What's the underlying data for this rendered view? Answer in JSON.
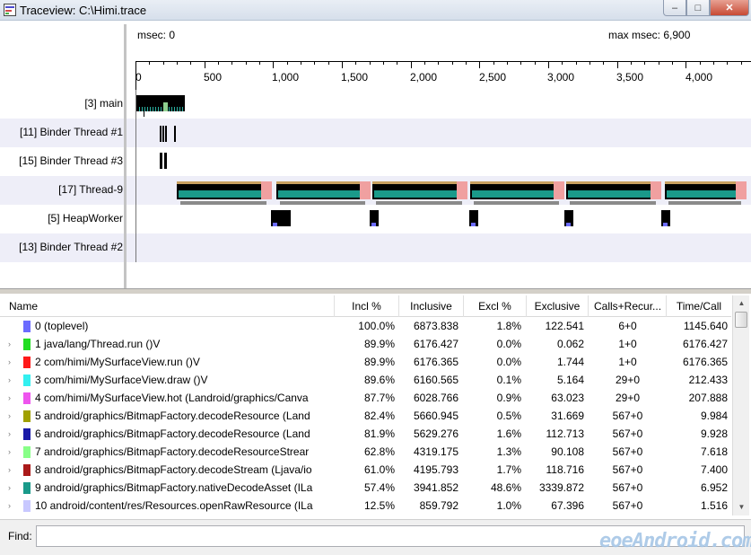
{
  "window": {
    "title": "Traceview: C:\\Himi.trace",
    "min_glyph": "–",
    "max_glyph": "□",
    "close_glyph": "✕"
  },
  "timeline": {
    "msec_start": "msec: 0",
    "max_msec": "max msec: 6,900",
    "tick_labels": [
      "0",
      "500",
      "1,000",
      "1,500",
      "2,000",
      "2,500",
      "3,000",
      "3,500",
      "4,000"
    ],
    "threads": [
      {
        "label": "[3] main"
      },
      {
        "label": "[11] Binder Thread #1"
      },
      {
        "label": "[15] Binder Thread #3"
      },
      {
        "label": "[17] Thread-9"
      },
      {
        "label": "[5] HeapWorker"
      },
      {
        "label": "[13] Binder Thread #2"
      }
    ]
  },
  "table": {
    "columns": [
      "Name",
      "Incl %",
      "Inclusive",
      "Excl %",
      "Exclusive",
      "Calls+Recur...",
      "Time/Call"
    ],
    "rows": [
      {
        "name": "0 (toplevel)",
        "color": "#6b6bff",
        "expander": "",
        "incl_pct": "100.0%",
        "inclusive": "6873.838",
        "excl_pct": "1.8%",
        "exclusive": "122.541",
        "calls": "6+0",
        "time_call": "1145.640"
      },
      {
        "name": "1 java/lang/Thread.run ()V",
        "color": "#22dd22",
        "expander": "›",
        "incl_pct": "89.9%",
        "inclusive": "6176.427",
        "excl_pct": "0.0%",
        "exclusive": "0.062",
        "calls": "1+0",
        "time_call": "6176.427"
      },
      {
        "name": "2 com/himi/MySurfaceView.run ()V",
        "color": "#ff1a1a",
        "expander": "›",
        "incl_pct": "89.9%",
        "inclusive": "6176.365",
        "excl_pct": "0.0%",
        "exclusive": "1.744",
        "calls": "1+0",
        "time_call": "6176.365"
      },
      {
        "name": "3 com/himi/MySurfaceView.draw ()V",
        "color": "#33f0f0",
        "expander": "›",
        "incl_pct": "89.6%",
        "inclusive": "6160.565",
        "excl_pct": "0.1%",
        "exclusive": "5.164",
        "calls": "29+0",
        "time_call": "212.433"
      },
      {
        "name": "4 com/himi/MySurfaceView.hot (Landroid/graphics/Canva",
        "color": "#ee55ee",
        "expander": "›",
        "incl_pct": "87.7%",
        "inclusive": "6028.766",
        "excl_pct": "0.9%",
        "exclusive": "63.023",
        "calls": "29+0",
        "time_call": "207.888"
      },
      {
        "name": "5 android/graphics/BitmapFactory.decodeResource (Land",
        "color": "#a0a000",
        "expander": "›",
        "incl_pct": "82.4%",
        "inclusive": "5660.945",
        "excl_pct": "0.5%",
        "exclusive": "31.669",
        "calls": "567+0",
        "time_call": "9.984"
      },
      {
        "name": "6 android/graphics/BitmapFactory.decodeResource (Land",
        "color": "#1a1aa8",
        "expander": "›",
        "incl_pct": "81.9%",
        "inclusive": "5629.276",
        "excl_pct": "1.6%",
        "exclusive": "112.713",
        "calls": "567+0",
        "time_call": "9.928"
      },
      {
        "name": "7 android/graphics/BitmapFactory.decodeResourceStrear",
        "color": "#88ff88",
        "expander": "›",
        "incl_pct": "62.8%",
        "inclusive": "4319.175",
        "excl_pct": "1.3%",
        "exclusive": "90.108",
        "calls": "567+0",
        "time_call": "7.618"
      },
      {
        "name": "8 android/graphics/BitmapFactory.decodeStream (Ljava/io",
        "color": "#aa1a1a",
        "expander": "›",
        "incl_pct": "61.0%",
        "inclusive": "4195.793",
        "excl_pct": "1.7%",
        "exclusive": "118.716",
        "calls": "567+0",
        "time_call": "7.400"
      },
      {
        "name": "9 android/graphics/BitmapFactory.nativeDecodeAsset (ILa",
        "color": "#1a9a8a",
        "expander": "›",
        "incl_pct": "57.4%",
        "inclusive": "3941.852",
        "excl_pct": "48.6%",
        "exclusive": "3339.872",
        "calls": "567+0",
        "time_call": "6.952"
      },
      {
        "name": "10 android/content/res/Resources.openRawResource (ILa",
        "color": "#c8c8ff",
        "expander": "›",
        "incl_pct": "12.5%",
        "inclusive": "859.792",
        "excl_pct": "1.0%",
        "exclusive": "67.396",
        "calls": "567+0",
        "time_call": "1.516"
      }
    ]
  },
  "find": {
    "label": "Find:",
    "value": "",
    "placeholder": ""
  },
  "watermark": "eoeAndroid.com"
}
